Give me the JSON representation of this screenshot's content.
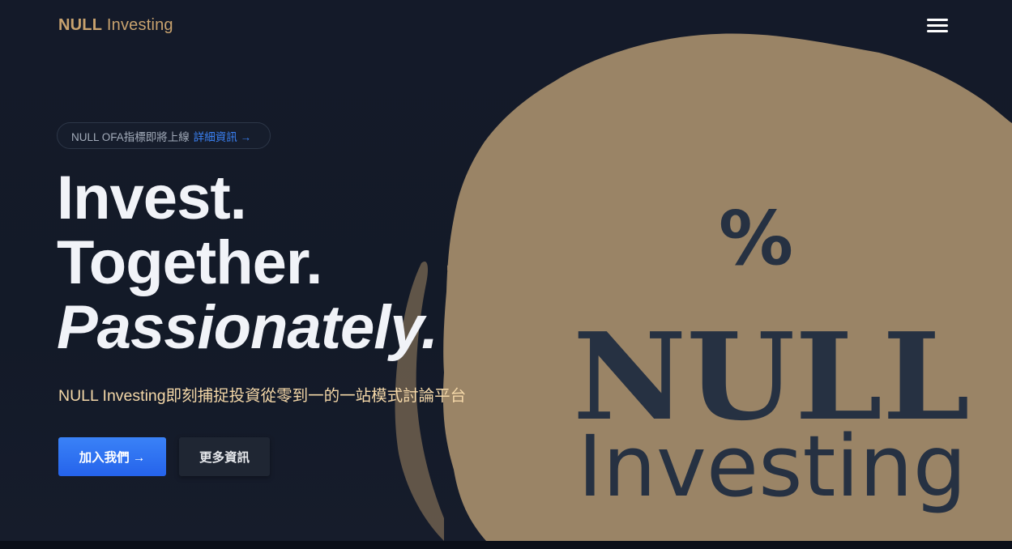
{
  "header": {
    "logo_bold": "NULL",
    "logo_light": "Investing",
    "menu_icon": "hamburger-menu-icon"
  },
  "announcement": {
    "text": "NULL OFA指標即將上線",
    "link_label": "詳細資訊 →"
  },
  "hero": {
    "headline_line1": "Invest.",
    "headline_line2": "Together.",
    "headline_line3": "Passionately.",
    "subtitle": "NULL Investing即刻捕捉投資從零到一的一站模式討論平台",
    "primary_button": "加入我們 →",
    "secondary_button": "更多資訊"
  },
  "brand_art": {
    "symbol": "%",
    "word_bold": "NULL",
    "word_light": "Investing"
  },
  "colors": {
    "background": "#141a29",
    "accent_gold": "#c8a26e",
    "blob_tan": "#9a8466",
    "logo_navy": "#263142",
    "link_blue": "#3b82f6",
    "button_blue": "#2563eb"
  }
}
